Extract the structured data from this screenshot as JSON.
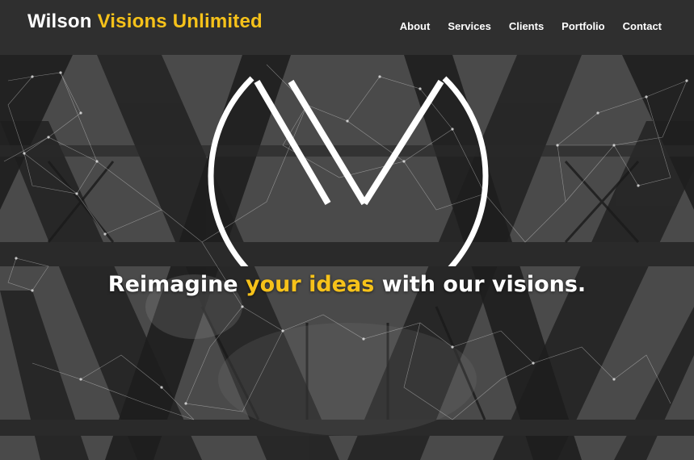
{
  "header": {
    "brand_part1": "Wilson",
    "brand_part2": "Visions Unlimited",
    "nav": [
      "About",
      "Services",
      "Clients",
      "Portfolio",
      "Contact"
    ]
  },
  "hero": {
    "tagline_start": "Reimagine ",
    "tagline_highlight": "your ideas",
    "tagline_end": " with our visions.",
    "logo_icon": "w-circle-logo-icon",
    "background": "industrial-truss-photo-with-network-lines"
  },
  "colors": {
    "accent": "#f6c21a",
    "navbar": "#2f2f2f",
    "text": "#ffffff"
  }
}
